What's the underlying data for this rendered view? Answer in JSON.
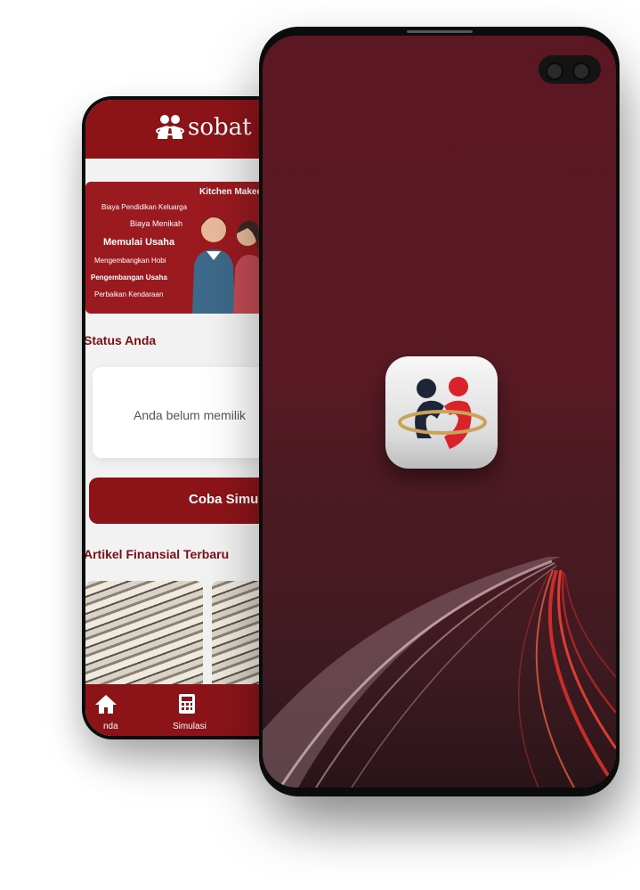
{
  "colors": {
    "brand_red": "#8c1419",
    "splash_bg": "#5b1722",
    "icon_dark": "#1e2538",
    "icon_red": "#d9222a",
    "icon_gold": "#c9a35a"
  },
  "back_app": {
    "brand": "sobat",
    "banner": {
      "lines": [
        "Kitchen Makeo",
        "Biaya Pendidikan Keluarga",
        "Biaya Menikah",
        "Memulai Usaha",
        "Mengembangkan Hobi",
        "Pengembangan Usaha",
        "Perbaikan Kendaraan"
      ]
    },
    "status": {
      "title": "Status Anda",
      "message": "Anda belum memilik"
    },
    "simulate_button": "Coba Simul",
    "articles_title": "Artikel Finansial Terbaru",
    "nav": {
      "home_label": "nda",
      "sim_label": "Simulasi"
    }
  },
  "front_app": {
    "screen": "splash",
    "icon": "sobat-logo-icon"
  }
}
